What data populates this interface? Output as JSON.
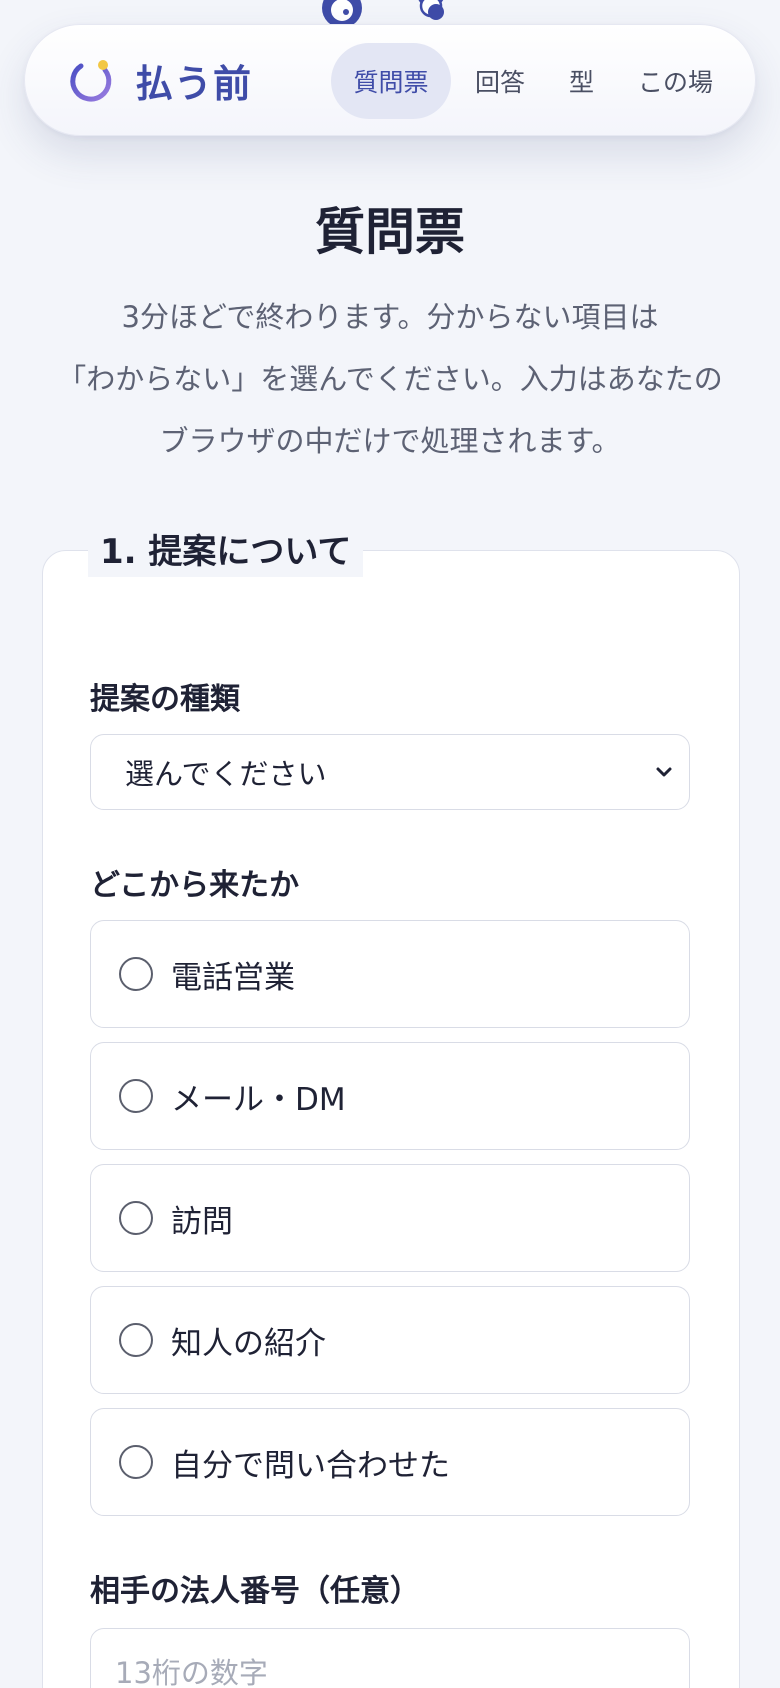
{
  "nav": {
    "brand": "払う前",
    "links": [
      {
        "label": "質問票",
        "active": true
      },
      {
        "label": "回答",
        "active": false
      },
      {
        "label": "型",
        "active": false
      },
      {
        "label": "この場",
        "active": false
      }
    ]
  },
  "header": {
    "title": "質問票",
    "intro_lines": [
      "3分ほどで終わります。分からない項目は",
      "「わからない」を選んでください。入力はあなたの",
      "ブラウザの中だけで処理されます。"
    ]
  },
  "section": {
    "legend": "1. 提案について",
    "proposal_type": {
      "label": "提案の種類",
      "selected": "選んでください"
    },
    "source": {
      "label": "どこから来たか",
      "options": [
        "電話営業",
        "メール・DM",
        "訪問",
        "知人の紹介",
        "自分で問い合わせた"
      ]
    },
    "corporate_number": {
      "label": "相手の法人番号（任意）",
      "placeholder": "13桁の数字"
    }
  },
  "colors": {
    "accent": "#3f4ca8",
    "background": "#f3f5fa",
    "border": "#d9dce6",
    "logo_dot": "#f2c744"
  },
  "icons": {
    "brand": "crescent-logo-icon",
    "select": "chevron-down-icon",
    "radio": "radio-circle-icon"
  }
}
